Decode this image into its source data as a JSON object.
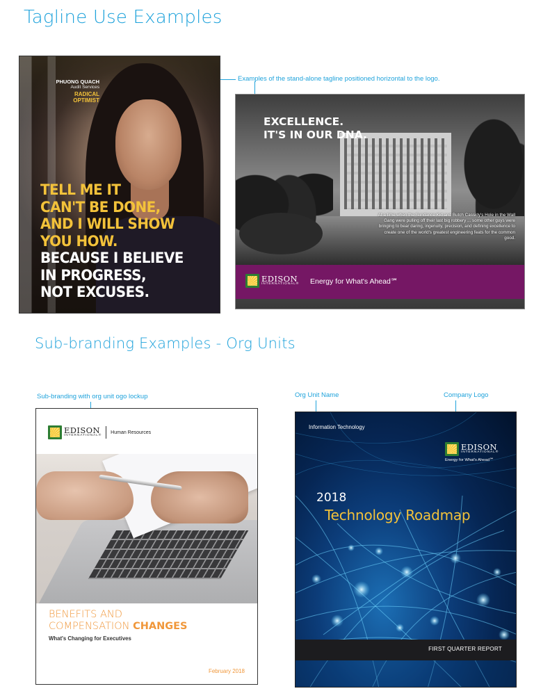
{
  "sections": {
    "tagline_title": "Tagline Use Examples",
    "subbranding_title": "Sub-branding Examples - Org Units"
  },
  "callouts": {
    "tagline_note": "Examples of the stand-alone tagline positioned horizontal to the logo.",
    "lockup_note": "Sub-branding with org unit ogo lockup",
    "org_unit_name": "Org Unit Name",
    "company_logo": "Company Logo"
  },
  "poster": {
    "name": "PHUONG QUACH",
    "department": "Audit Services",
    "role": "RADICAL OPTIMIST",
    "quote_yellow": [
      "TELL ME IT",
      "CAN'T BE DONE,",
      "AND I WILL SHOW",
      "YOU HOW."
    ],
    "quote_white": [
      "BECAUSE I BELIEVE",
      "IN PROGRESS,",
      "NOT EXCUSES."
    ]
  },
  "ad": {
    "headline_line1": "EXCELLENCE.",
    "headline_line2": "IT'S IN OUR DNA.",
    "body_copy": "At a time when the Sundance Kid and Butch Cassidy's Hole in the Wall Gang were pulling off their last big robbery ... some other guys were bringing to bear daring, ingenuity, precision, and defining excellence to create one of the world's greatest engineering feats for the common good.",
    "logo_word": "EDISON",
    "logo_sub": "INTERNATIONAL®",
    "tagline": "Energy for What's Ahead℠",
    "bar_color": "#751764"
  },
  "brochure": {
    "logo_word": "EDISON",
    "logo_sub": "INTERNATIONAL®",
    "org_unit": "Human Resources",
    "title_line1": "BENEFITS AND",
    "title_line2_light": "COMPENSATION ",
    "title_line2_bold": "CHANGES",
    "subtitle": "What's Changing for Executives",
    "date": "February 2018",
    "accent_color": "#f0973a"
  },
  "roadmap": {
    "org_unit": "Information Technology",
    "logo_word": "EDISON",
    "logo_sub": "INTERNATIONAL®",
    "logo_tagline": "Energy for What's Ahead℠",
    "year": "2018",
    "title": "Technology Roadmap",
    "report": "FIRST QUARTER REPORT",
    "title_color": "#f3c23a"
  }
}
